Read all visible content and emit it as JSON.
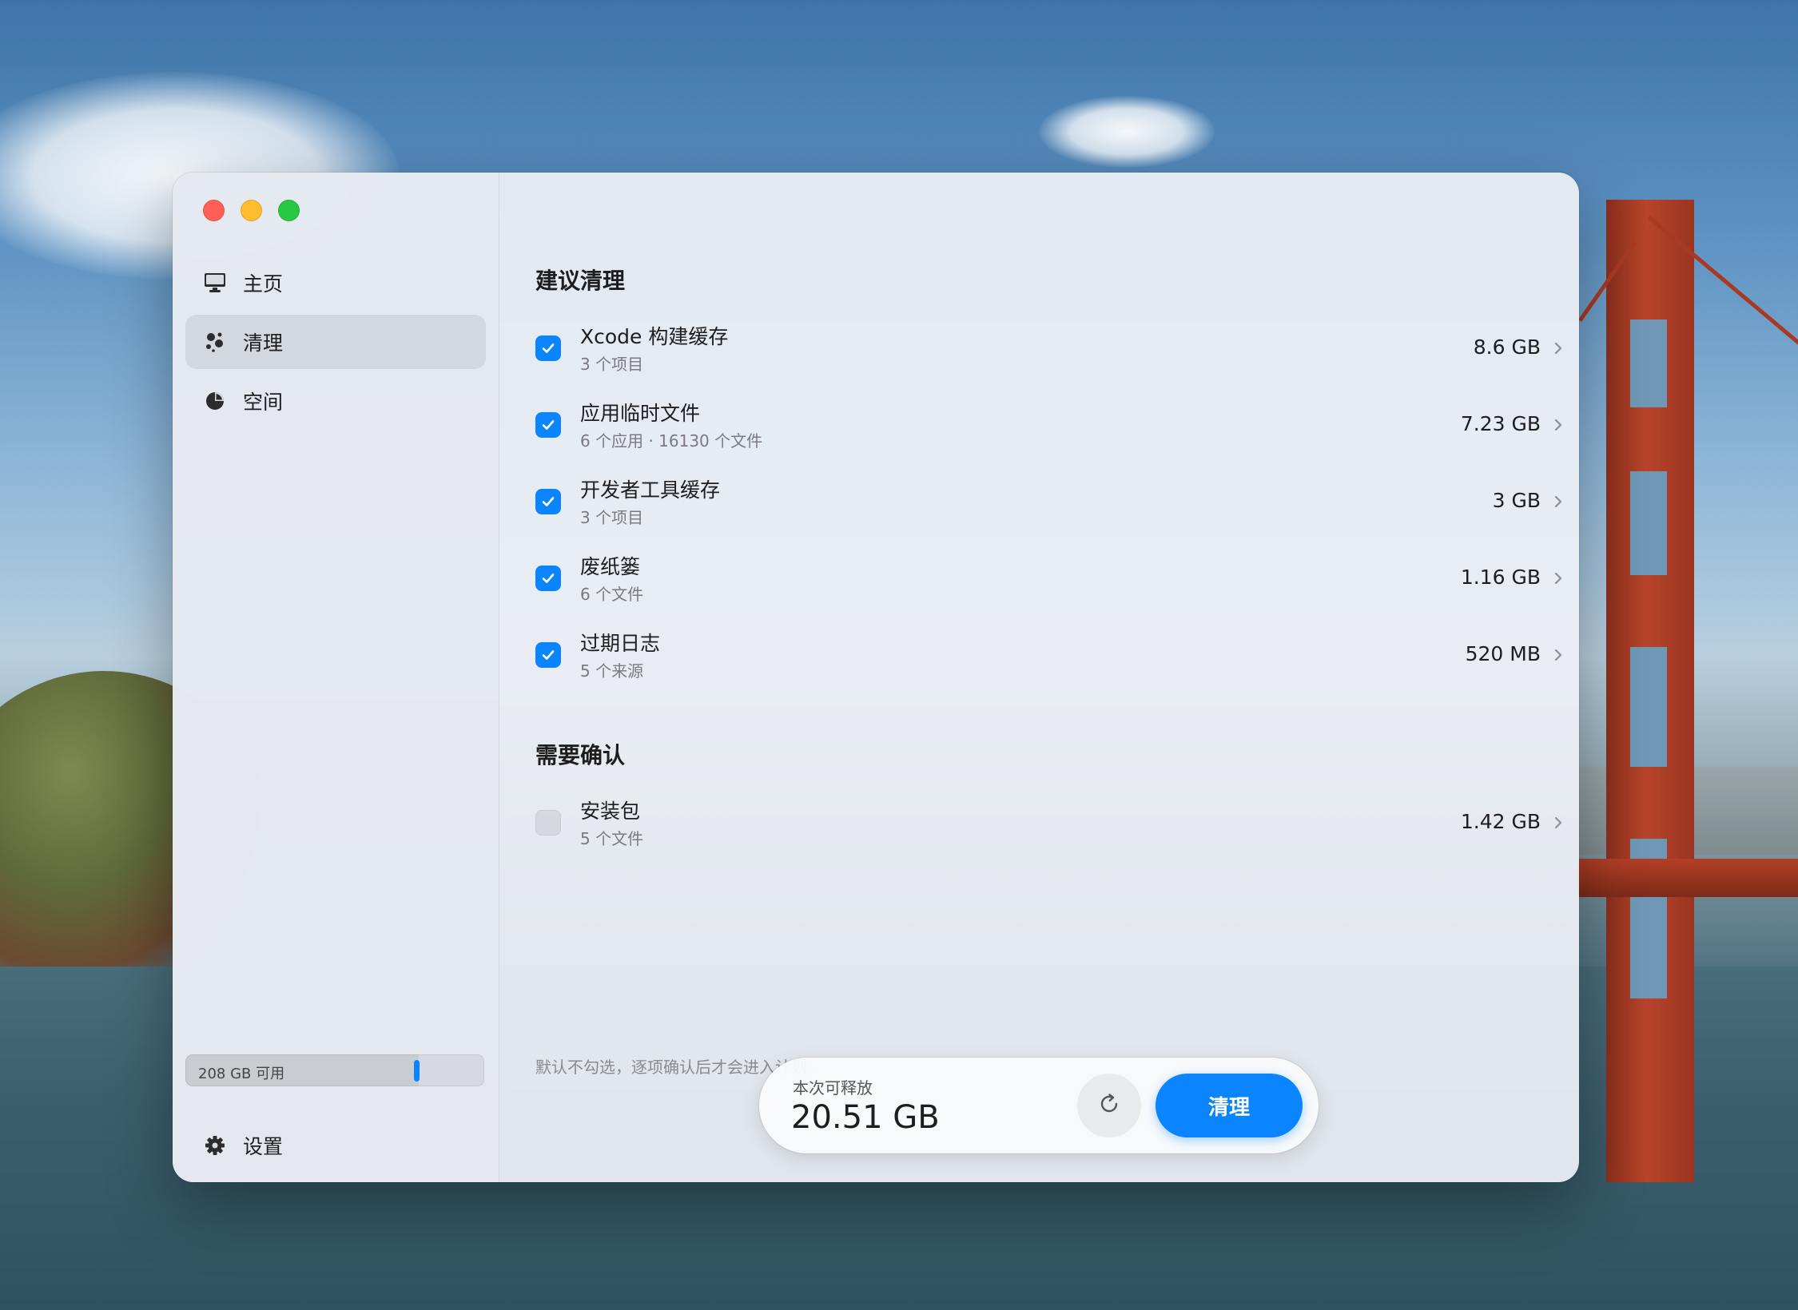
{
  "window": {
    "traffic_lights": [
      "close",
      "minimize",
      "zoom"
    ]
  },
  "sidebar": {
    "items": [
      {
        "label": "主页",
        "icon": "monitor-icon",
        "active": false
      },
      {
        "label": "清理",
        "icon": "sparkles-icon",
        "active": true
      },
      {
        "label": "空间",
        "icon": "pie-chart-icon",
        "active": false
      }
    ],
    "storage": {
      "label": "208 GB 可用",
      "used_fraction": 0.78
    },
    "settings": {
      "label": "设置",
      "icon": "gear-icon"
    }
  },
  "recommended": {
    "title": "建议清理",
    "items": [
      {
        "title": "Xcode 构建缓存",
        "subtitle": "3 个项目",
        "size": "8.6 GB",
        "checked": true
      },
      {
        "title": "应用临时文件",
        "subtitle": "6 个应用 · 16130 个文件",
        "size": "7.23 GB",
        "checked": true
      },
      {
        "title": "开发者工具缓存",
        "subtitle": "3 个项目",
        "size": "3 GB",
        "checked": true
      },
      {
        "title": "废纸篓",
        "subtitle": "6 个文件",
        "size": "1.16 GB",
        "checked": true
      },
      {
        "title": "过期日志",
        "subtitle": "5 个来源",
        "size": "520 MB",
        "checked": true
      }
    ]
  },
  "needs_confirm": {
    "title": "需要确认",
    "items": [
      {
        "title": "安装包",
        "subtitle": "5 个文件",
        "size": "1.42 GB",
        "checked": false
      }
    ],
    "note": "默认不勾选，逐项确认后才会进入计划。"
  },
  "action_bar": {
    "label": "本次可释放",
    "value": "20.51 GB",
    "refresh_icon": "refresh-icon",
    "button_label": "清理"
  },
  "colors": {
    "accent": "#0a84ff",
    "close": "#fe5f57",
    "minimize": "#febc2e",
    "zoom": "#28c840"
  }
}
